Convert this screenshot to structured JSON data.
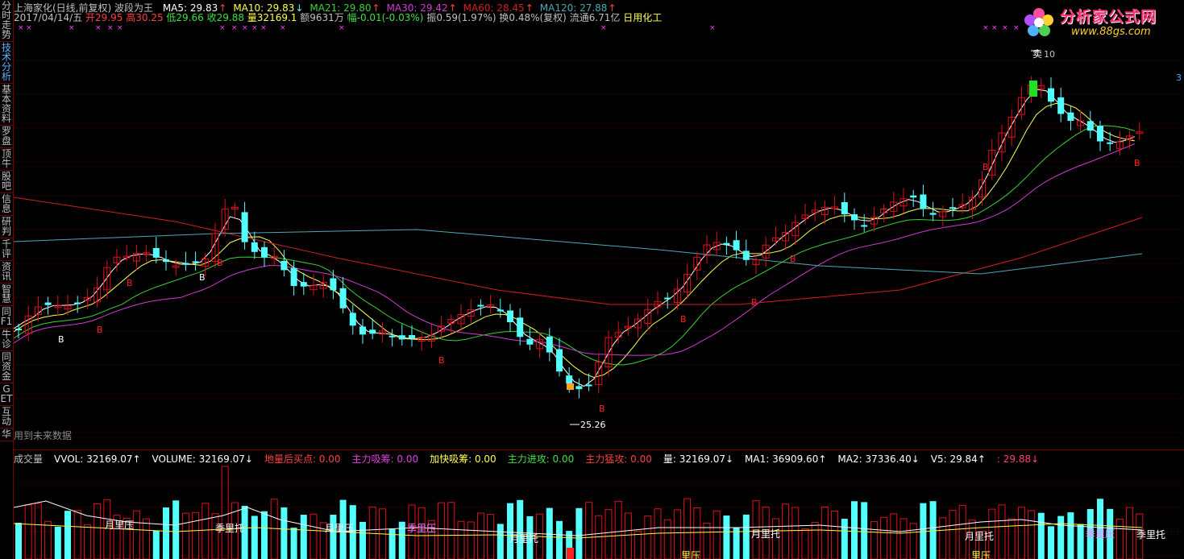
{
  "sidebar": {
    "items": [
      {
        "label": "分时走势",
        "active": false
      },
      {
        "label": "技术分析",
        "active": true
      },
      {
        "label": "基本资料",
        "active": false
      },
      {
        "label": "罗盘",
        "active": false
      },
      {
        "label": "顶牛",
        "active": false
      },
      {
        "label": "股吧",
        "active": false
      },
      {
        "label": "信息",
        "active": false
      },
      {
        "label": "研判",
        "active": false
      },
      {
        "label": "千评",
        "active": false
      },
      {
        "label": "资讯",
        "active": false
      },
      {
        "label": "智慧",
        "active": false
      },
      {
        "label": "同F1",
        "active": false
      },
      {
        "label": "牛诊",
        "active": false
      },
      {
        "label": "同资金",
        "active": false
      },
      {
        "label": "GET",
        "active": false
      },
      {
        "label": "互动",
        "active": false
      },
      {
        "label": "华",
        "active": false
      }
    ]
  },
  "header": {
    "stock": "上海家化(日线,前复权) 波段为王",
    "ma": [
      {
        "label": "MA5: 29.83",
        "arrow": "↑",
        "color": "#ffffff"
      },
      {
        "label": "MA10: 29.83",
        "arrow": "↓",
        "color": "#ffff50"
      },
      {
        "label": "MA21: 29.80",
        "arrow": "↑",
        "color": "#39d139"
      },
      {
        "label": "MA30: 29.42",
        "arrow": "↑",
        "color": "#d03cd0"
      },
      {
        "label": "MA60: 28.45",
        "arrow": "↑",
        "color": "#d02020"
      },
      {
        "label": "MA120: 27.88",
        "arrow": "↑",
        "color": "#4ea8b5"
      }
    ],
    "date": "2017/04/14/五",
    "open": "开29.95",
    "high": "高30.25",
    "low": "低29.66",
    "close": "收29.88",
    "volume": "量32169.1",
    "amount": "额9631万",
    "change": "幅-0.01(-0.03%)",
    "amplitude": "振0.59(1.97%)",
    "turnover": "换0.48%(复权)",
    "float": "流通6.71亿",
    "industry": "日用化工"
  },
  "logo": {
    "name": "分析家公式网",
    "url": "www.88gs.com"
  },
  "chart_labels": {
    "high_mark": "10",
    "sell_mark": "卖",
    "low_mark": "25.26",
    "future_note": "用到未来数据",
    "buy": "B",
    "right_edge": "3"
  },
  "volume_header": [
    {
      "text": "成交量",
      "color": "#c0c0c0"
    },
    {
      "text": "VVOL: 32169.07↑",
      "color": "#ffffff"
    },
    {
      "text": "VOLUME: 32169.07↓",
      "color": "#ffffff"
    },
    {
      "text": "地量后买点: 0.00",
      "color": "#ff4040"
    },
    {
      "text": "主力吸筹: 0.00",
      "color": "#e040e0"
    },
    {
      "text": "加快吸筹: 0.00",
      "color": "#ffff50"
    },
    {
      "text": "主力进攻: 0.00",
      "color": "#40e040"
    },
    {
      "text": "主力猛攻: 0.00",
      "color": "#ff4040"
    },
    {
      "text": "量: 32169.07↓",
      "color": "#ffffff"
    },
    {
      "text": "MA1: 36909.60↑",
      "color": "#ffffff"
    },
    {
      "text": "MA2: 37336.40↓",
      "color": "#ffffff"
    },
    {
      "text": "V5: 29.84↑",
      "color": "#ffffff"
    },
    {
      "text": ": 29.88↓",
      "color": "#ff4070"
    }
  ],
  "volume_labels": [
    {
      "text": "月里压",
      "color": "#ffffff"
    },
    {
      "text": "季里托",
      "color": "#ffffff"
    },
    {
      "text": "月里压",
      "color": "#ffffff"
    },
    {
      "text": "季里压",
      "color": "#ff80ff"
    },
    {
      "text": "月里托",
      "color": "#ffffff"
    },
    {
      "text": "月里托",
      "color": "#ffffff"
    },
    {
      "text": "月里托",
      "color": "#ffffff"
    },
    {
      "text": "季里压",
      "color": "#ff80ff"
    },
    {
      "text": "季里托",
      "color": "#ffffff"
    },
    {
      "text": "里压",
      "color": "#ffff50"
    },
    {
      "text": "里压",
      "color": "#ffff50"
    }
  ],
  "colors": {
    "up": "#e0101a",
    "down": "#54ffff",
    "grid": "#7a0000",
    "bg": "#000000"
  }
}
